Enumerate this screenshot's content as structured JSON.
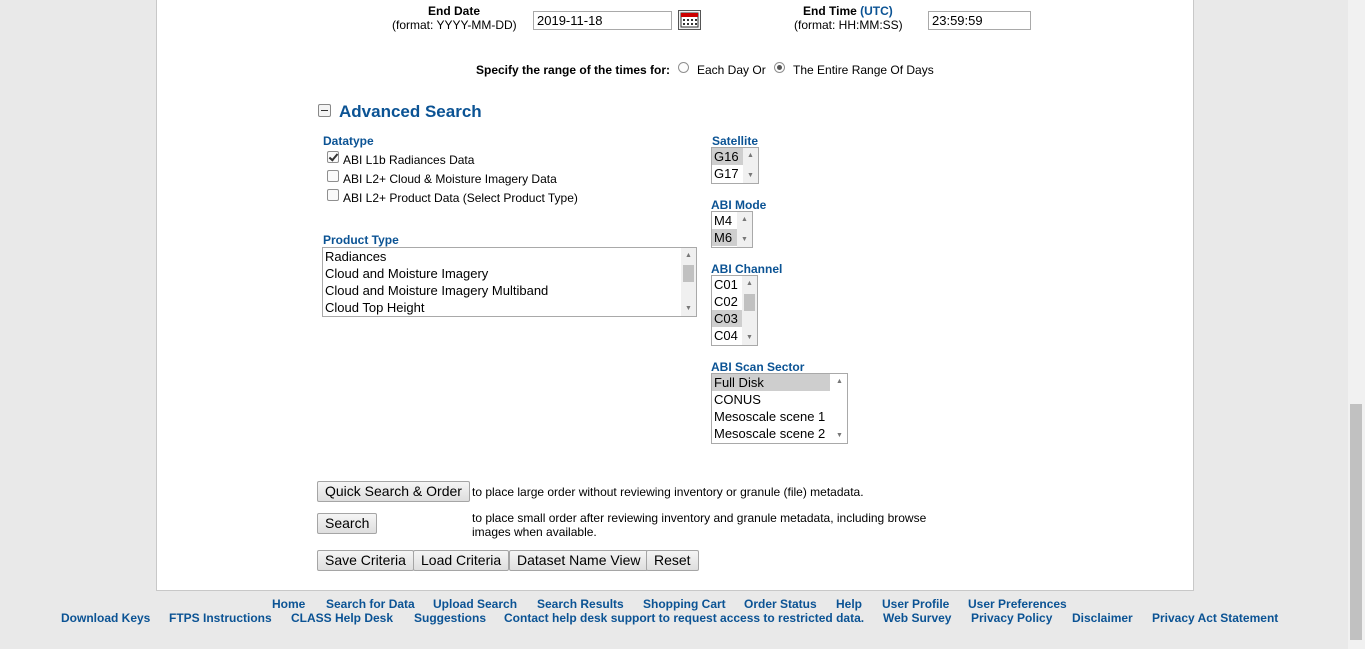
{
  "end_date": {
    "label": "End Date",
    "format": "(format: YYYY-MM-DD)",
    "value": "2019-11-18"
  },
  "end_time": {
    "label": "End Time",
    "utc": "(UTC)",
    "format": "(format: HH:MM:SS)",
    "value": "23:59:59"
  },
  "range": {
    "label": "Specify the range of the times for:",
    "option_each_day": "Each Day Or",
    "option_entire_range": "The Entire Range Of Days",
    "selected": "entire_range"
  },
  "advanced_search": {
    "title": "Advanced Search",
    "datatype": {
      "title": "Datatype",
      "options": [
        {
          "label": "ABI L1b Radiances Data",
          "checked": true
        },
        {
          "label": "ABI L2+ Cloud & Moisture Imagery Data",
          "checked": false
        },
        {
          "label": "ABI L2+ Product Data (Select Product Type)",
          "checked": false
        }
      ]
    },
    "product_type": {
      "title": "Product Type",
      "options": [
        "Radiances",
        "Cloud and Moisture Imagery",
        "Cloud and Moisture Imagery Multiband",
        "Cloud Top Height"
      ]
    },
    "satellite": {
      "title": "Satellite",
      "options": [
        "G16",
        "G17"
      ],
      "selected": [
        "G16"
      ]
    },
    "abi_mode": {
      "title": "ABI Mode",
      "options": [
        "M4",
        "M6"
      ],
      "selected": [
        "M6"
      ]
    },
    "abi_channel": {
      "title": "ABI Channel",
      "options": [
        "C01",
        "C02",
        "C03",
        "C04"
      ],
      "selected": [
        "C03"
      ]
    },
    "abi_scan_sector": {
      "title": "ABI Scan Sector",
      "options": [
        "Full Disk",
        "CONUS",
        "Mesoscale scene 1",
        "Mesoscale scene 2"
      ],
      "selected": [
        "Full Disk"
      ]
    }
  },
  "actions": {
    "quick_search_label": "Quick Search & Order",
    "quick_search_desc": "to place large order without reviewing inventory or granule (file) metadata.",
    "search_label": "Search",
    "search_desc": "to place small order after reviewing inventory and granule metadata, including browse images when available.",
    "save_criteria": "Save Criteria",
    "load_criteria": "Load Criteria",
    "dataset_name_view": "Dataset Name View",
    "reset": "Reset"
  },
  "footer": {
    "row1": [
      "Home",
      "Search for Data",
      "Upload Search",
      "Search Results",
      "Shopping Cart",
      "Order Status",
      "Help",
      "User Profile",
      "User Preferences"
    ],
    "row2": [
      "Download Keys",
      "FTPS Instructions",
      "CLASS Help Desk",
      "Suggestions",
      "Contact help desk support to request access to restricted data.",
      "Web Survey",
      "Privacy Policy",
      "Disclaimer",
      "Privacy Act Statement"
    ]
  },
  "colors": {
    "link": "#0b5394",
    "page_bg": "#e9e9e9",
    "panel_bg": "#ffffff",
    "selected_option": "#cecece"
  },
  "icons": {
    "calendar": "calendar-icon",
    "collapse": "minus-box-icon"
  }
}
